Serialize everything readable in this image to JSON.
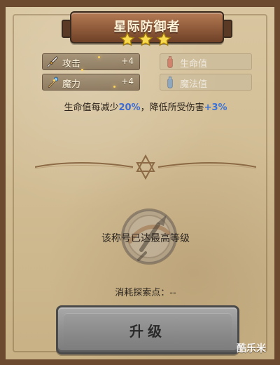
{
  "title": "星际防御者",
  "stars": {
    "count": 3,
    "color": "#f6d12b",
    "outline": "#a07a0e"
  },
  "stats": {
    "left": [
      {
        "label": "攻击",
        "value": "+4",
        "icon": "sword-icon"
      },
      {
        "label": "魔力",
        "value": "+4",
        "icon": "staff-icon"
      }
    ],
    "right": [
      {
        "label": "生命值",
        "icon": "health-potion-icon"
      },
      {
        "label": "魔法值",
        "icon": "mana-potion-icon"
      }
    ]
  },
  "bonus": {
    "prefix": "生命值每减少",
    "p1": "20%",
    "middle": "，降低所受伤害",
    "p2": "+3%"
  },
  "max_level_text": "该称号已达最高等级",
  "cost_text": "消耗探索点：--",
  "upgrade_label": "升级",
  "watermark": "酷乐米"
}
